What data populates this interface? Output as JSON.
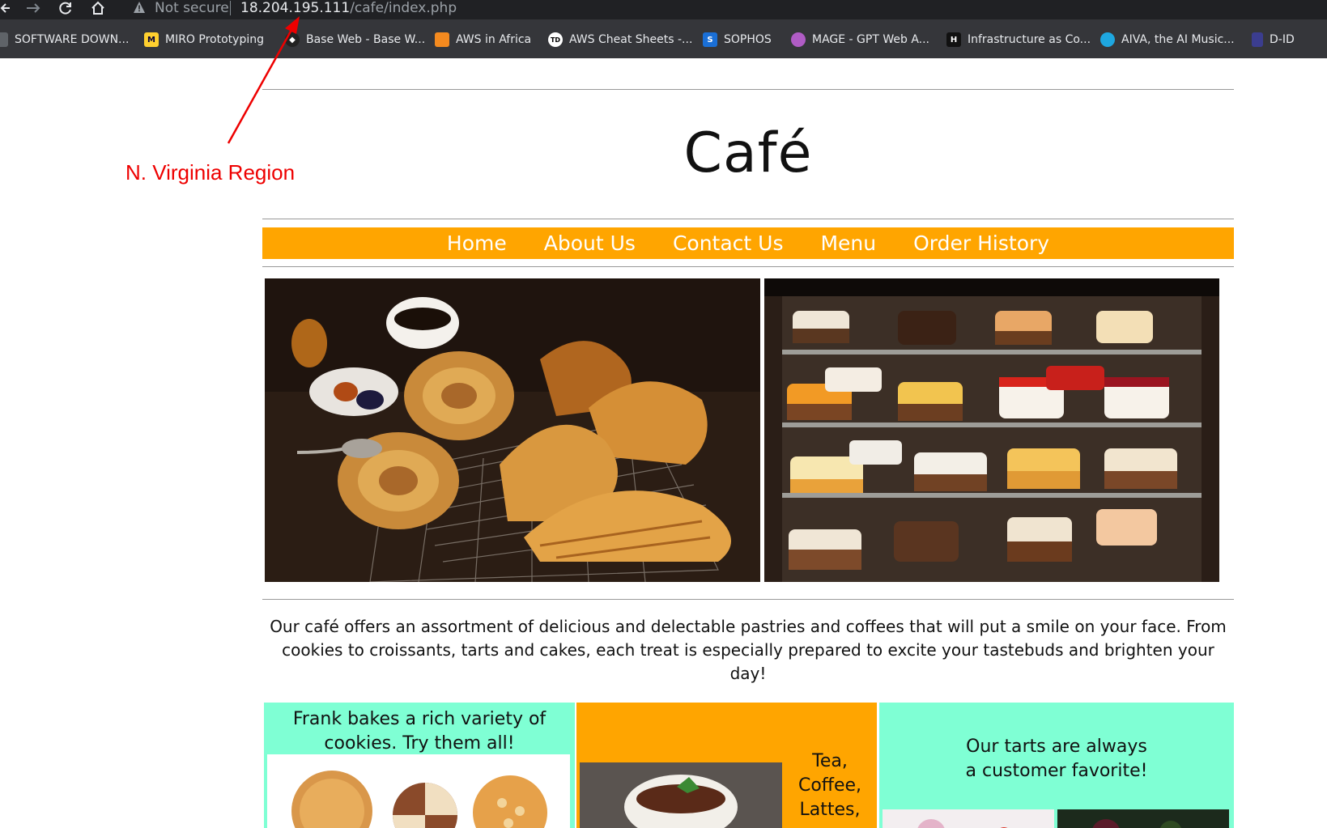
{
  "browser": {
    "security_label": "Not secure",
    "url_host": "18.204.195.111",
    "url_path": "/cafe/index.php"
  },
  "bookmarks": [
    {
      "label": "SOFTWARE DOWN...",
      "icon": "software-icon",
      "color": "#5f6368"
    },
    {
      "label": "MIRO Prototyping",
      "icon": "miro-icon",
      "color": "#ffd02f"
    },
    {
      "label": "Base Web - Base W...",
      "icon": "baseweb-icon",
      "color": "#111111"
    },
    {
      "label": "AWS in Africa",
      "icon": "aws-cube-icon",
      "color": "#f48a1f"
    },
    {
      "label": "AWS Cheat Sheets -...",
      "icon": "td-icon",
      "color": "#ffffff"
    },
    {
      "label": "SOPHOS",
      "icon": "sophos-icon",
      "color": "#1a6fd6"
    },
    {
      "label": "MAGE - GPT Web A...",
      "icon": "mage-icon",
      "color": "#b05cc5"
    },
    {
      "label": "Infrastructure as Co...",
      "icon": "hashicorp-icon",
      "color": "#111111"
    },
    {
      "label": "AIVA, the AI Music...",
      "icon": "aiva-icon",
      "color": "#1ea7e0"
    },
    {
      "label": "D-ID",
      "icon": "did-icon",
      "color": "#3b3d8f"
    }
  ],
  "annotation": {
    "label": "N. Virginia Region",
    "color": "#ee0000"
  },
  "site": {
    "title": "Café",
    "nav": [
      "Home",
      "About Us",
      "Contact Us",
      "Menu",
      "Order History"
    ],
    "accent": "#ffa500",
    "mint": "#7fffd4",
    "intro": "Our café offers an assortment of delicious and delectable pastries and coffees that will put a smile on your face. From cookies to croissants, tarts and cakes, each treat is especially prepared to excite your tastebuds and brighten your day!",
    "boxes": {
      "cookies": "Frank bakes a rich variety of cookies. Try them all!",
      "drinks": "Tea, Coffee, Lattes,",
      "tarts_line1": "Our tarts are always",
      "tarts_line2": "a customer favorite!"
    }
  }
}
